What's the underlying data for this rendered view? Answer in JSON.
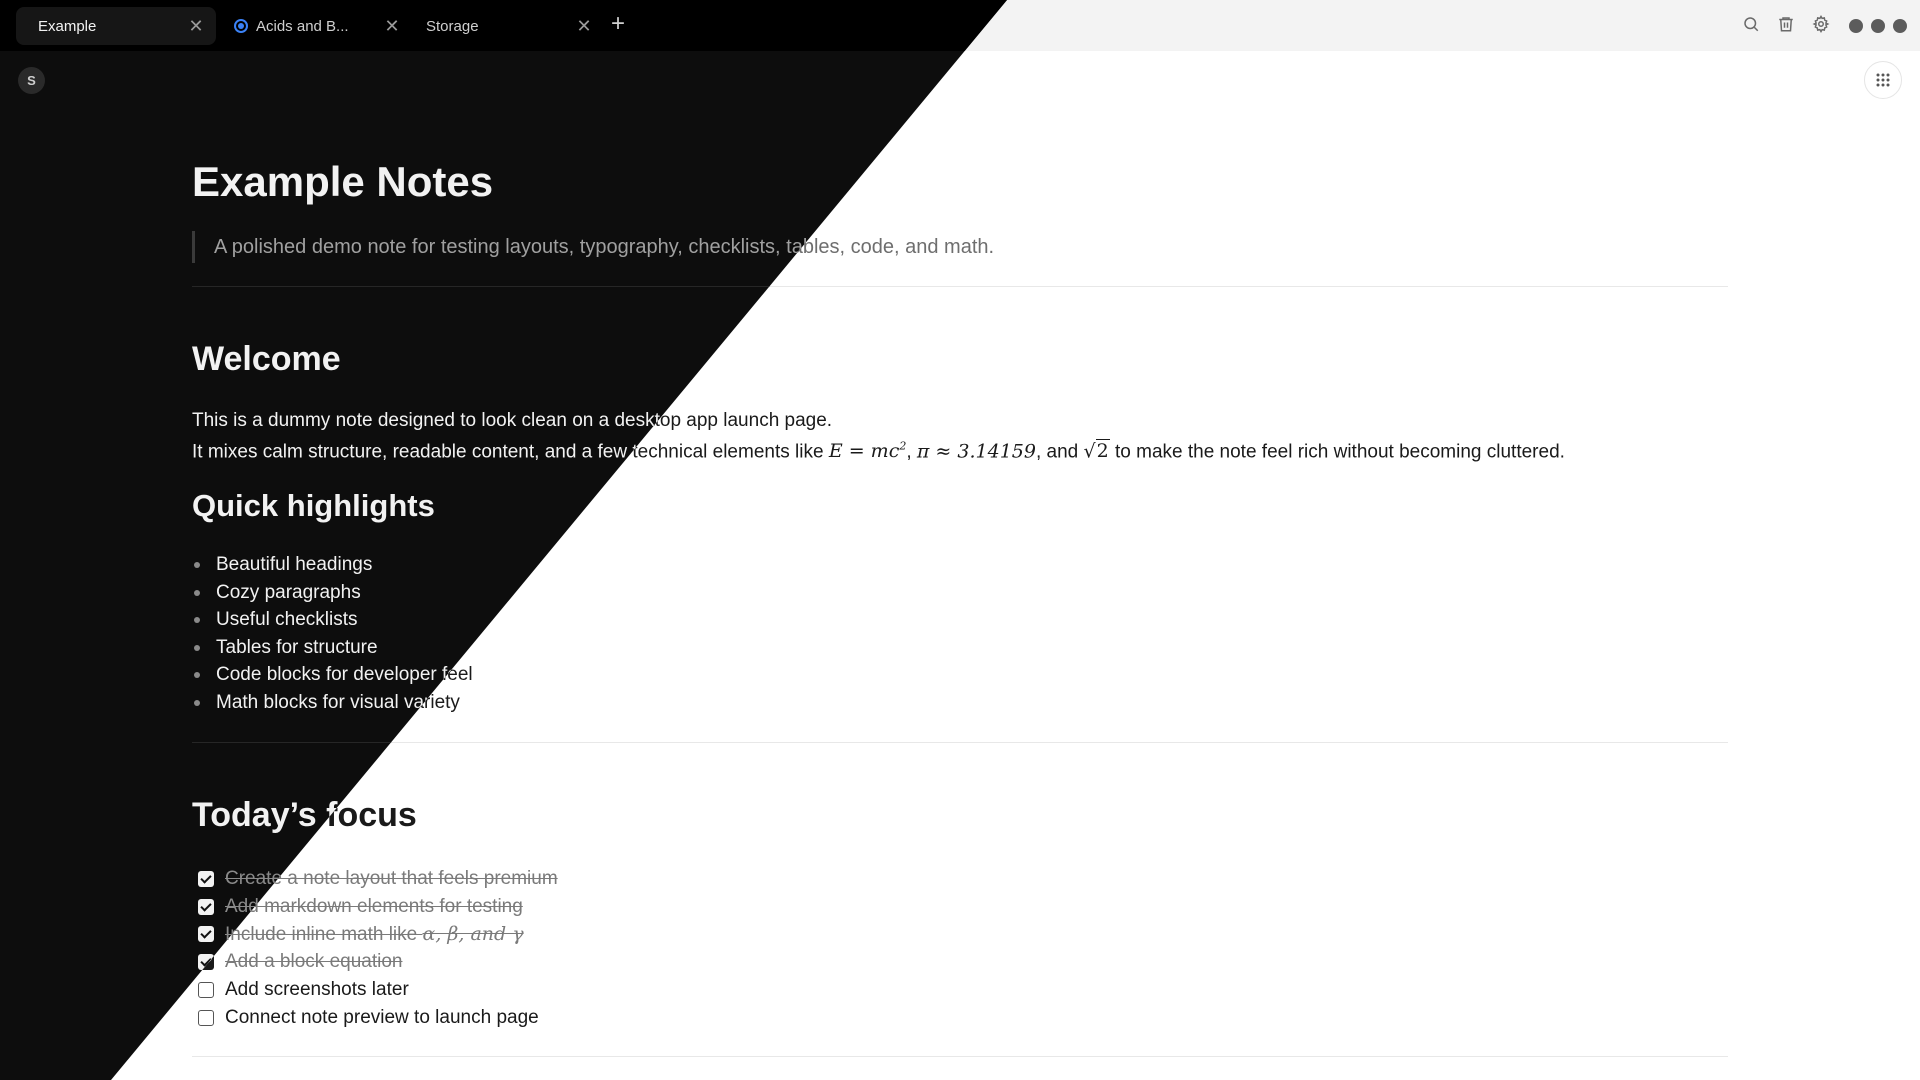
{
  "tabs": [
    {
      "label": "Example",
      "active": true,
      "icon": "none"
    },
    {
      "label": "Acids and B...",
      "active": false,
      "icon": "radio-dot-icon"
    },
    {
      "label": "Storage",
      "active": false,
      "icon": "none"
    }
  ],
  "tab_close_glyph": "✕",
  "add_tab_glyph": "+",
  "toolbar": {
    "icons": [
      "search-icon",
      "trash-icon",
      "gear-icon"
    ],
    "window_controls": [
      "window-dot-icon",
      "window-dot-icon",
      "window-dot-icon"
    ]
  },
  "app_badge": "S",
  "note": {
    "title": "Example Notes",
    "subtitle": "A polished demo note for testing layouts, typography, checklists, tables, code, and math.",
    "welcome": {
      "heading": "Welcome",
      "line1": "This is a dummy note designed to look clean on a desktop app launch page.",
      "line2_start": "It mixes calm structure, readable content, and a few technical elements like ",
      "math_e": "E = mc",
      "math_e_sup": "2",
      "sep1": ", ",
      "math_pi": "π ≈ 3.14159",
      "sep2": ", and ",
      "math_sqrt_sign": "√",
      "math_sqrt_arg": "2",
      "line2_end": " to make the note feel rich without becoming cluttered."
    },
    "highlights": {
      "heading": "Quick highlights",
      "items": [
        "Beautiful headings",
        "Cozy paragraphs",
        "Useful checklists",
        "Tables for structure",
        "Code blocks for developer feel",
        "Math blocks for visual variety"
      ]
    },
    "focus": {
      "heading": "Today’s focus",
      "items": [
        {
          "text": "Create a note layout that feels premium",
          "done": true
        },
        {
          "text": "Add markdown elements for testing",
          "done": true
        },
        {
          "text": "Include inline math like ",
          "math": "α, β, and γ",
          "done": true
        },
        {
          "text": "Add a block equation",
          "done": true
        },
        {
          "text": "Add screenshots later",
          "done": false
        },
        {
          "text": "Connect note preview to launch page",
          "done": false
        }
      ]
    }
  },
  "colors": {
    "accent_blue": "#3b82f6",
    "dark_bg": "#0d0d0d",
    "light_bg": "#ffffff"
  }
}
